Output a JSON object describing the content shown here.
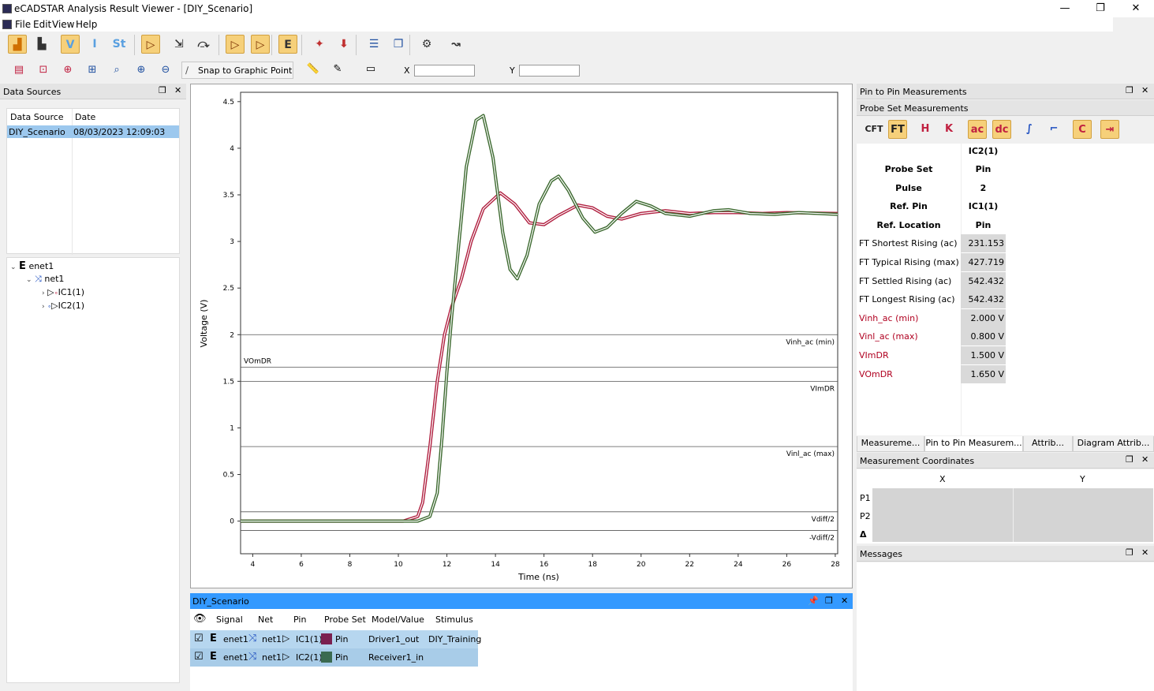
{
  "window": {
    "title": "eCADSTAR Analysis Result Viewer - [DIY_Scenario]",
    "min": "—",
    "max": "❐",
    "close": "✕"
  },
  "menu": [
    "File",
    "Edit",
    "View",
    "Help"
  ],
  "toolbar1": [
    {
      "name": "chart-icon",
      "glyph": "▟",
      "active": true,
      "color": "#d07000"
    },
    {
      "name": "bar-chart-icon",
      "glyph": "▙",
      "active": false,
      "color": "#333"
    },
    {
      "name": "voltage-icon",
      "glyph": "V",
      "active": true,
      "color": "#5aa0e0"
    },
    {
      "name": "current-icon",
      "glyph": "I",
      "active": false,
      "color": "#5aa0e0"
    },
    {
      "name": "state-icon",
      "glyph": "St",
      "active": false,
      "color": "#5aa0e0"
    },
    {
      "name": "probe-driver-icon",
      "glyph": "▷",
      "active": true,
      "color": "#7a3000"
    },
    {
      "name": "probe-arrow-icon",
      "glyph": "⇲",
      "active": false,
      "color": "#333"
    },
    {
      "name": "probe-split-icon",
      "glyph": "⤼",
      "active": false,
      "color": "#333"
    },
    {
      "name": "driver-pin-icon",
      "glyph": "▷",
      "active": true,
      "color": "#7a3000"
    },
    {
      "name": "receiver-pin-icon",
      "glyph": "▷",
      "active": true,
      "color": "#7a3000"
    },
    {
      "name": "enet-icon",
      "glyph": "E",
      "active": true,
      "color": "#333"
    },
    {
      "name": "star-icon",
      "glyph": "✦",
      "active": false,
      "color": "#c03030"
    },
    {
      "name": "import-icon",
      "glyph": "⬇",
      "active": false,
      "color": "#c03030"
    },
    {
      "name": "split-horizontal-icon",
      "glyph": "☰",
      "active": false,
      "color": "#2050a0"
    },
    {
      "name": "cascade-icon",
      "glyph": "❐",
      "active": false,
      "color": "#2050a0"
    },
    {
      "name": "settings-icon",
      "glyph": "⚙",
      "active": false,
      "color": "#333"
    },
    {
      "name": "wrench-icon",
      "glyph": "↝",
      "active": false,
      "color": "#333"
    }
  ],
  "toolbar2": {
    "icons": [
      {
        "name": "table-icon",
        "glyph": "▤",
        "color": "#c02040"
      },
      {
        "name": "fit-icon",
        "glyph": "⊡",
        "color": "#c02040"
      },
      {
        "name": "zoom-region-icon",
        "glyph": "⊕",
        "color": "#c02040"
      },
      {
        "name": "zoom-fit-icon",
        "glyph": "⊞",
        "color": "#2050a0"
      },
      {
        "name": "zoom-window-icon",
        "glyph": "⌕",
        "color": "#2050a0"
      },
      {
        "name": "zoom-in-icon",
        "glyph": "⊕",
        "color": "#2050a0"
      },
      {
        "name": "zoom-out-icon",
        "glyph": "⊖",
        "color": "#2050a0"
      }
    ],
    "snap_label": "Snap to Graphic Point",
    "x_label": "X",
    "y_label": "Y",
    "x_value": "",
    "y_value": ""
  },
  "data_sources": {
    "title": "Data Sources",
    "columns": [
      "Data Source",
      "Date"
    ],
    "rows": [
      {
        "source": "DIY_Scenario",
        "date": "08/03/2023 12:09:03"
      }
    ],
    "tree": [
      {
        "label": "enet1",
        "level": 0
      },
      {
        "label": "net1",
        "level": 1
      },
      {
        "label": "IC1(1)",
        "level": 2
      },
      {
        "label": "IC2(1)",
        "level": 2
      }
    ]
  },
  "chart_data": {
    "type": "line",
    "xlabel": "Time (ns)",
    "ylabel": "Voltage (V)",
    "xlim": [
      3.5,
      28.1
    ],
    "ylim": [
      -0.35,
      4.6
    ],
    "xticks": [
      4,
      6,
      8,
      10,
      12,
      14,
      16,
      18,
      20,
      22,
      24,
      26,
      28
    ],
    "yticks": [
      0,
      0.5,
      1,
      1.5,
      2,
      2.5,
      3,
      3.5,
      4,
      4.5
    ],
    "ytick_labels": [
      "0",
      "0.5",
      "1",
      "1.5",
      "2",
      "2.5",
      "3",
      "3.5",
      "4",
      "4.5"
    ],
    "thresholds": [
      {
        "label": "Vinh_ac (min)",
        "value": 2.0,
        "align": "right"
      },
      {
        "label": "VOmDR",
        "value": 1.65,
        "align": "left"
      },
      {
        "label": "VImDR",
        "value": 1.5,
        "align": "right"
      },
      {
        "label": "Vinl_ac (max)",
        "value": 0.8,
        "align": "right"
      },
      {
        "label": "Vdiff/2",
        "value": 0.1,
        "align": "right"
      },
      {
        "label": "-Vdiff/2",
        "value": -0.1,
        "align": "right"
      }
    ],
    "series": [
      {
        "color": "#b02040",
        "points": [
          [
            3.5,
            0
          ],
          [
            10.2,
            0
          ],
          [
            10.8,
            0.05
          ],
          [
            11.0,
            0.2
          ],
          [
            11.3,
            0.8
          ],
          [
            11.6,
            1.5
          ],
          [
            11.9,
            2.0
          ],
          [
            12.2,
            2.3
          ],
          [
            12.6,
            2.6
          ],
          [
            13.0,
            3.0
          ],
          [
            13.5,
            3.35
          ],
          [
            14.2,
            3.52
          ],
          [
            14.8,
            3.4
          ],
          [
            15.4,
            3.2
          ],
          [
            16.0,
            3.18
          ],
          [
            16.6,
            3.28
          ],
          [
            17.4,
            3.39
          ],
          [
            18.0,
            3.36
          ],
          [
            18.6,
            3.27
          ],
          [
            19.2,
            3.24
          ],
          [
            20.0,
            3.3
          ],
          [
            21.0,
            3.33
          ],
          [
            22.0,
            3.3
          ],
          [
            23.0,
            3.31
          ],
          [
            24.0,
            3.31
          ],
          [
            25.0,
            3.3
          ],
          [
            26.0,
            3.31
          ],
          [
            28.1,
            3.3
          ]
        ]
      },
      {
        "color": "#3d6a30",
        "points": [
          [
            3.5,
            0
          ],
          [
            10.8,
            0
          ],
          [
            11.3,
            0.05
          ],
          [
            11.6,
            0.3
          ],
          [
            11.8,
            0.9
          ],
          [
            12.0,
            1.6
          ],
          [
            12.2,
            2.2
          ],
          [
            12.5,
            3.0
          ],
          [
            12.8,
            3.8
          ],
          [
            13.2,
            4.3
          ],
          [
            13.5,
            4.35
          ],
          [
            13.9,
            3.9
          ],
          [
            14.3,
            3.1
          ],
          [
            14.6,
            2.7
          ],
          [
            14.9,
            2.6
          ],
          [
            15.3,
            2.85
          ],
          [
            15.8,
            3.4
          ],
          [
            16.3,
            3.65
          ],
          [
            16.6,
            3.7
          ],
          [
            17.0,
            3.55
          ],
          [
            17.6,
            3.25
          ],
          [
            18.1,
            3.1
          ],
          [
            18.6,
            3.15
          ],
          [
            19.2,
            3.3
          ],
          [
            19.8,
            3.43
          ],
          [
            20.4,
            3.38
          ],
          [
            21.0,
            3.3
          ],
          [
            22.0,
            3.27
          ],
          [
            23.0,
            3.33
          ],
          [
            23.6,
            3.34
          ],
          [
            24.5,
            3.3
          ],
          [
            25.5,
            3.29
          ],
          [
            26.5,
            3.31
          ],
          [
            28.1,
            3.29
          ]
        ]
      }
    ]
  },
  "waveform_table": {
    "title": "DIY_Scenario",
    "columns": [
      "Signal",
      "Net",
      "Pin",
      "Probe Set",
      "Model/Value",
      "Stimulus"
    ],
    "rows": [
      {
        "signal": "enet1",
        "net": "net1",
        "pin": "IC1(1)",
        "probe": "Pin",
        "model": "Driver1_out",
        "stimulus": "DIY_Training",
        "color": "#7a2050",
        "checked": "☑"
      },
      {
        "signal": "enet1",
        "net": "net1",
        "pin": "IC2(1)",
        "probe": "Pin",
        "model": "Receiver1_in",
        "stimulus": "",
        "color": "#3a6a50",
        "checked": "☑"
      }
    ]
  },
  "p2p": {
    "title": "Pin to Pin Measurements",
    "subtitle": "Probe Set Measurements",
    "icons": [
      {
        "name": "cft-icon",
        "glyph": "CFT",
        "active": false
      },
      {
        "name": "ft-icon",
        "glyph": "FT",
        "active": true
      },
      {
        "name": "rising-edge-icon",
        "glyph": "H",
        "active": false
      },
      {
        "name": "falling-edge-icon",
        "glyph": "K",
        "active": false
      },
      {
        "name": "ac-icon",
        "glyph": "ac",
        "active": true
      },
      {
        "name": "dc-icon",
        "glyph": "dc",
        "active": true
      },
      {
        "name": "ramp-up-icon",
        "glyph": "∫",
        "active": false
      },
      {
        "name": "ramp-down-icon",
        "glyph": "⌐",
        "active": false
      },
      {
        "name": "overshoot-icon",
        "glyph": "C",
        "active": true
      },
      {
        "name": "export-icon",
        "glyph": "⇥",
        "active": true
      }
    ],
    "column_header": "IC2(1)",
    "rows": [
      {
        "label": "Probe Set",
        "value": "Pin",
        "kind": "bold"
      },
      {
        "label": "Pulse",
        "value": "2",
        "kind": "bold"
      },
      {
        "label": "Ref. Pin",
        "value": "IC1(1)",
        "kind": "bold"
      },
      {
        "label": "Ref. Location",
        "value": "Pin",
        "kind": "bold"
      },
      {
        "label": "FT Shortest Rising (ac)",
        "value": "231.153 ps",
        "kind": "normal"
      },
      {
        "label": "FT Typical Rising (max)",
        "value": "427.719 ps",
        "kind": "normal"
      },
      {
        "label": "FT Settled Rising (ac)",
        "value": "542.432 ps",
        "kind": "normal"
      },
      {
        "label": "FT Longest Rising (ac)",
        "value": "542.432 ps",
        "kind": "normal"
      },
      {
        "label": "Vinh_ac (min)",
        "value": "2.000 V",
        "kind": "red"
      },
      {
        "label": "Vinl_ac (max)",
        "value": "0.800 V",
        "kind": "red"
      },
      {
        "label": "VImDR",
        "value": "1.500 V",
        "kind": "red"
      },
      {
        "label": "VOmDR",
        "value": "1.650 V",
        "kind": "red"
      }
    ],
    "tabs": [
      {
        "label": "Measureme...",
        "active": false
      },
      {
        "label": "Pin to Pin Measurem...",
        "active": true
      },
      {
        "label": "Attrib...",
        "active": false
      },
      {
        "label": "Diagram Attrib...",
        "active": false
      }
    ]
  },
  "coords": {
    "title": "Measurement Coordinates",
    "columns": [
      "X",
      "Y"
    ],
    "rows": [
      "P1",
      "P2",
      "Δ"
    ]
  },
  "messages": {
    "title": "Messages"
  }
}
